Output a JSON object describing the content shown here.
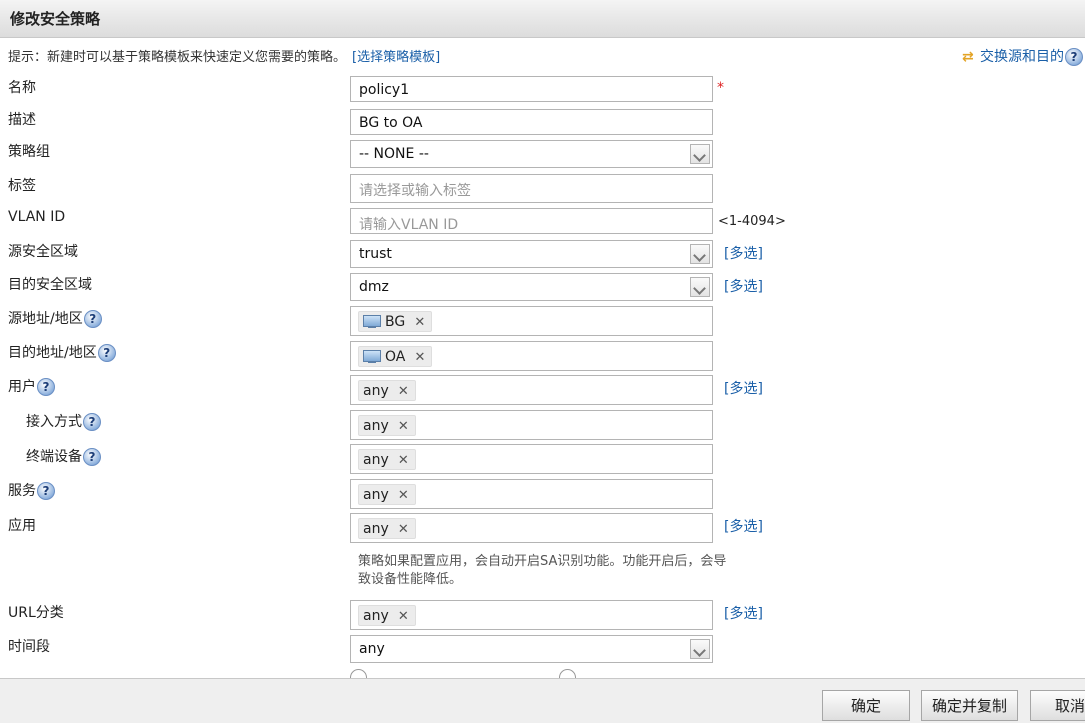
{
  "dialog": {
    "title": "修改安全策略"
  },
  "hint": {
    "text": "提示：新建时可以基于策略模板来快速定义您需要的策略。",
    "link": "[选择策略模板]"
  },
  "swap": {
    "label": "交换源和目的"
  },
  "help_glyph": "?",
  "remove_glyph": "✕",
  "fields": {
    "name": {
      "label": "名称",
      "value": "policy1",
      "required_mark": "*"
    },
    "description": {
      "label": "描述",
      "value": "BG to OA"
    },
    "policy_group": {
      "label": "策略组",
      "value": "-- NONE --"
    },
    "tag": {
      "label": "标签",
      "placeholder": "请选择或输入标签"
    },
    "vlan_id": {
      "label": "VLAN ID",
      "placeholder": "请输入VLAN ID",
      "range": "<1-4094>"
    },
    "src_zone": {
      "label": "源安全区域",
      "value": "trust",
      "multi": "[多选]"
    },
    "dst_zone": {
      "label": "目的安全区域",
      "value": "dmz",
      "multi": "[多选]"
    },
    "src_addr": {
      "label": "源地址/地区",
      "tag": "BG"
    },
    "dst_addr": {
      "label": "目的地址/地区",
      "tag": "OA"
    },
    "user": {
      "label": "用户",
      "tag": "any",
      "multi": "[多选]"
    },
    "access_mode": {
      "label": "接入方式",
      "tag": "any"
    },
    "terminal": {
      "label": "终端设备",
      "tag": "any"
    },
    "service": {
      "label": "服务",
      "tag": "any"
    },
    "application": {
      "label": "应用",
      "tag": "any",
      "multi": "[多选]",
      "note": "策略如果配置应用，会自动开启SA识别功能。功能开启后，会导致设备性能降低。"
    },
    "url_category": {
      "label": "URL分类",
      "tag": "any",
      "multi": "[多选]"
    },
    "time_range": {
      "label": "时间段",
      "value": "any"
    }
  },
  "buttons": {
    "ok": "确定",
    "ok_copy": "确定并复制",
    "cancel": "取消"
  }
}
